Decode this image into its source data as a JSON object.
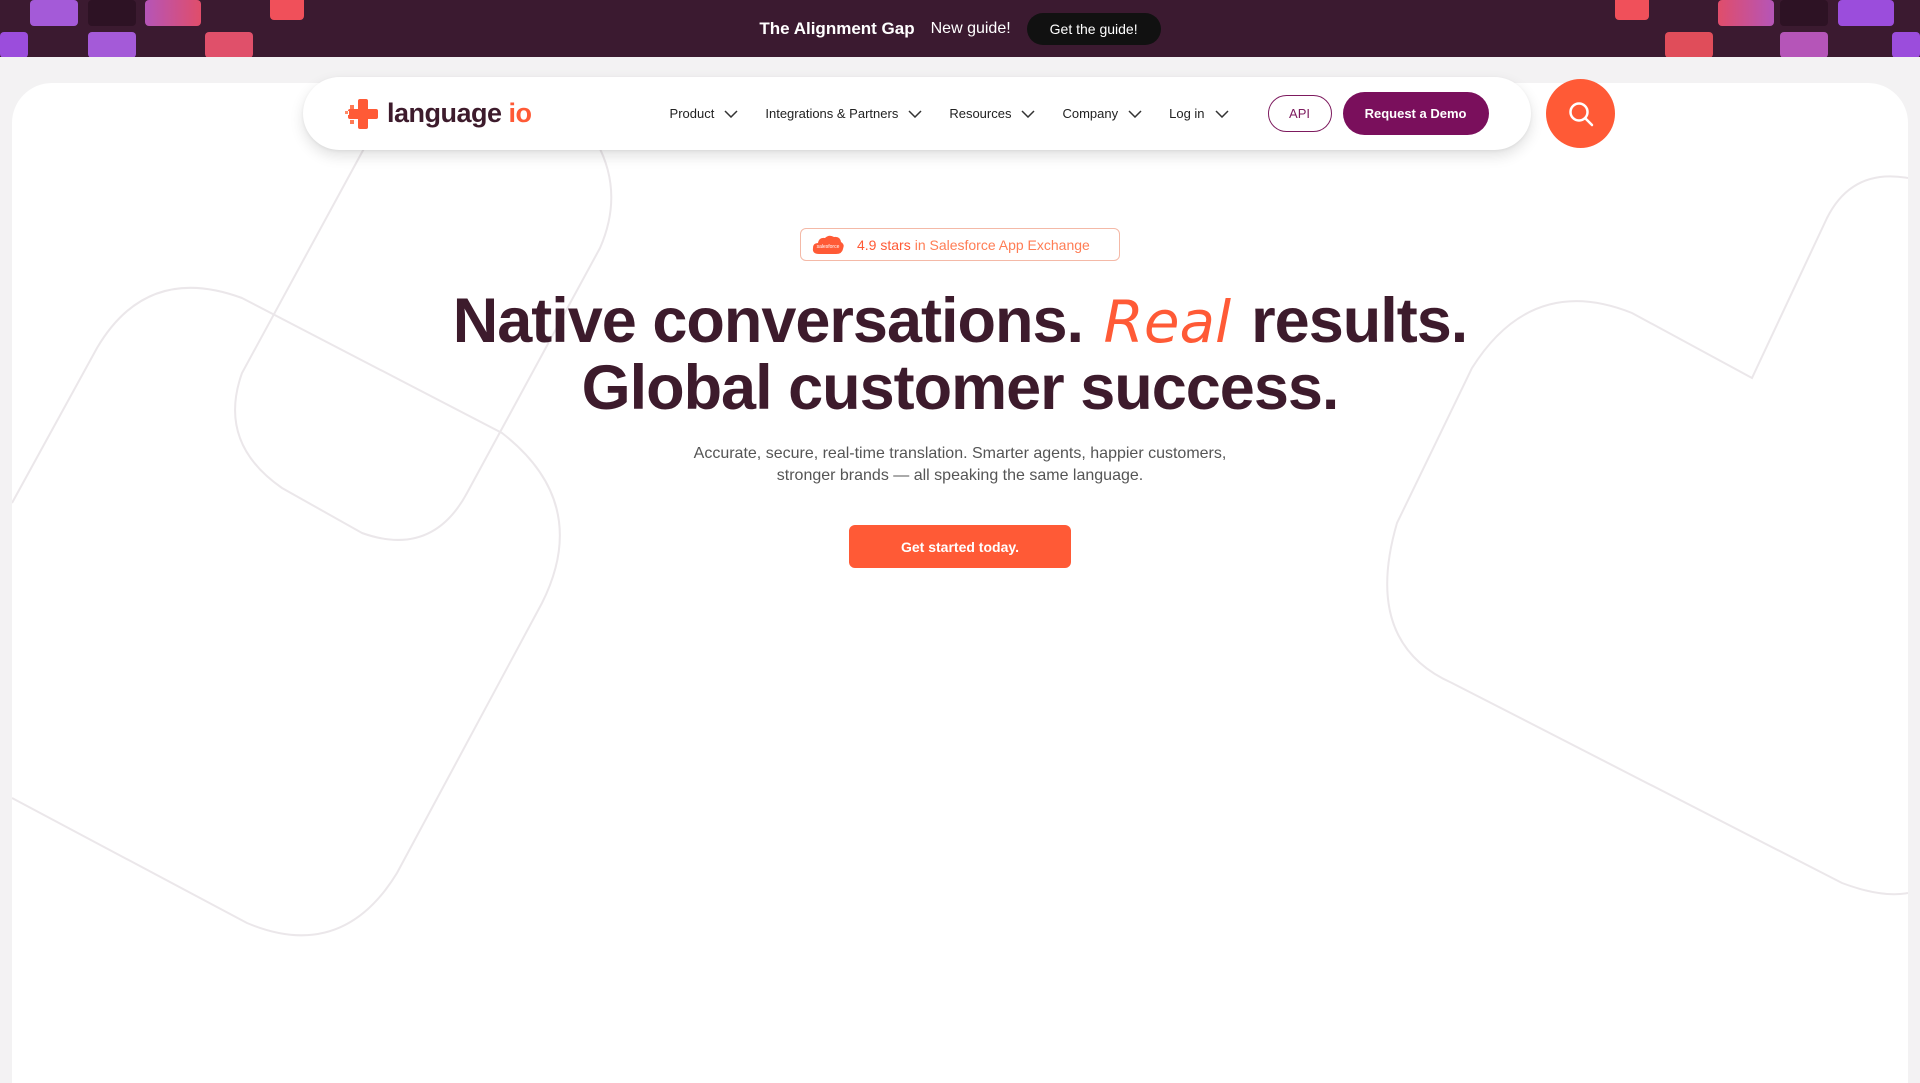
{
  "announcement": {
    "title": "The Alignment Gap",
    "tag": "New guide!",
    "button_label": "Get the guide!",
    "colors": {
      "background": "#3b1a30",
      "tile_coral": "#f0505a",
      "tile_purple": "#9b4ddc"
    }
  },
  "header": {
    "logo": {
      "name": "language",
      "suffix": "io"
    },
    "nav_items": [
      {
        "label": "Product"
      },
      {
        "label": "Integrations & Partners"
      },
      {
        "label": "Resources"
      },
      {
        "label": "Company"
      },
      {
        "label": "Log in"
      }
    ],
    "api_label": "API",
    "demo_label": "Request a Demo",
    "search_icon": "search-icon"
  },
  "hero": {
    "badge": {
      "icon": "salesforce-cloud-icon",
      "icon_text": "salesforce",
      "stars": "4.9 stars",
      "rest": "in Salesforce App Exchange"
    },
    "headline": {
      "line1_start": "Native conversations.",
      "highlight": "Real",
      "line1_end": "results.",
      "line2": "Global customer success."
    },
    "subtext": {
      "line1": "Accurate, secure, real-time translation. Smarter agents, happier customers,",
      "line2": "stronger brands — all speaking the same language."
    },
    "cta_label": "Get started today."
  },
  "colors": {
    "brand_orange": "#ff5a36",
    "brand_plum": "#7a0f5c",
    "text_dark": "#3d1b2c"
  }
}
